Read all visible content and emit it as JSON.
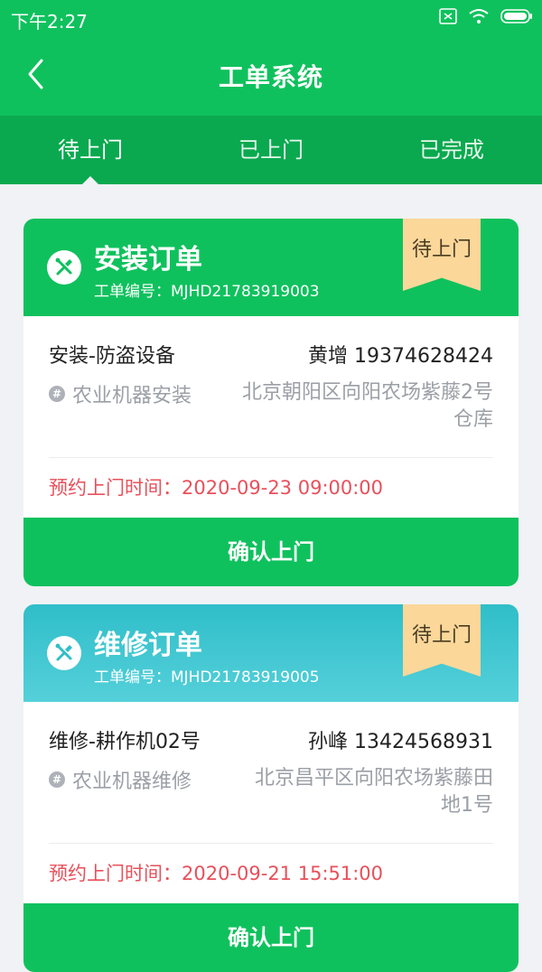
{
  "status_bar": {
    "time": "下午2:27"
  },
  "navbar": {
    "title": "工单系统"
  },
  "tabs": [
    {
      "label": "待上门"
    },
    {
      "label": "已上门"
    },
    {
      "label": "已完成"
    }
  ],
  "orders": [
    {
      "title": "安装订单",
      "code": "工单编号：MJHD21783919003",
      "status": "待上门",
      "service": "安装-防盗设备",
      "contact": "黄增 19374628424",
      "category": "农业机器安装",
      "address": "北京朝阳区向阳农场紫藤2号仓库",
      "appointment": "预约上门时间：2020-09-23 09:00:00",
      "action": "确认上门",
      "header_color": "#0fc15d"
    },
    {
      "title": "维修订单",
      "code": "工单编号：MJHD21783919005",
      "status": "待上门",
      "service": "维修-耕作机02号",
      "contact": "孙峰 13424568931",
      "category": "农业机器维修",
      "address": "北京昌平区向阳农场紫藤田地1号",
      "appointment": "预约上门时间：2020-09-21 15:51:00",
      "action": "确认上门",
      "header_color": "#3ac4cf"
    }
  ],
  "colors": {
    "primary": "#0fc15d",
    "primary_dark": "#0aa94f",
    "ribbon": "#fbd79a",
    "appointment_text": "#e8505b",
    "muted_text": "#9b9fa6"
  },
  "icons": [
    "back-arrow-icon",
    "wrench-screwdriver-icon",
    "hash-icon",
    "sim-icon",
    "wifi-icon",
    "battery-icon"
  ]
}
